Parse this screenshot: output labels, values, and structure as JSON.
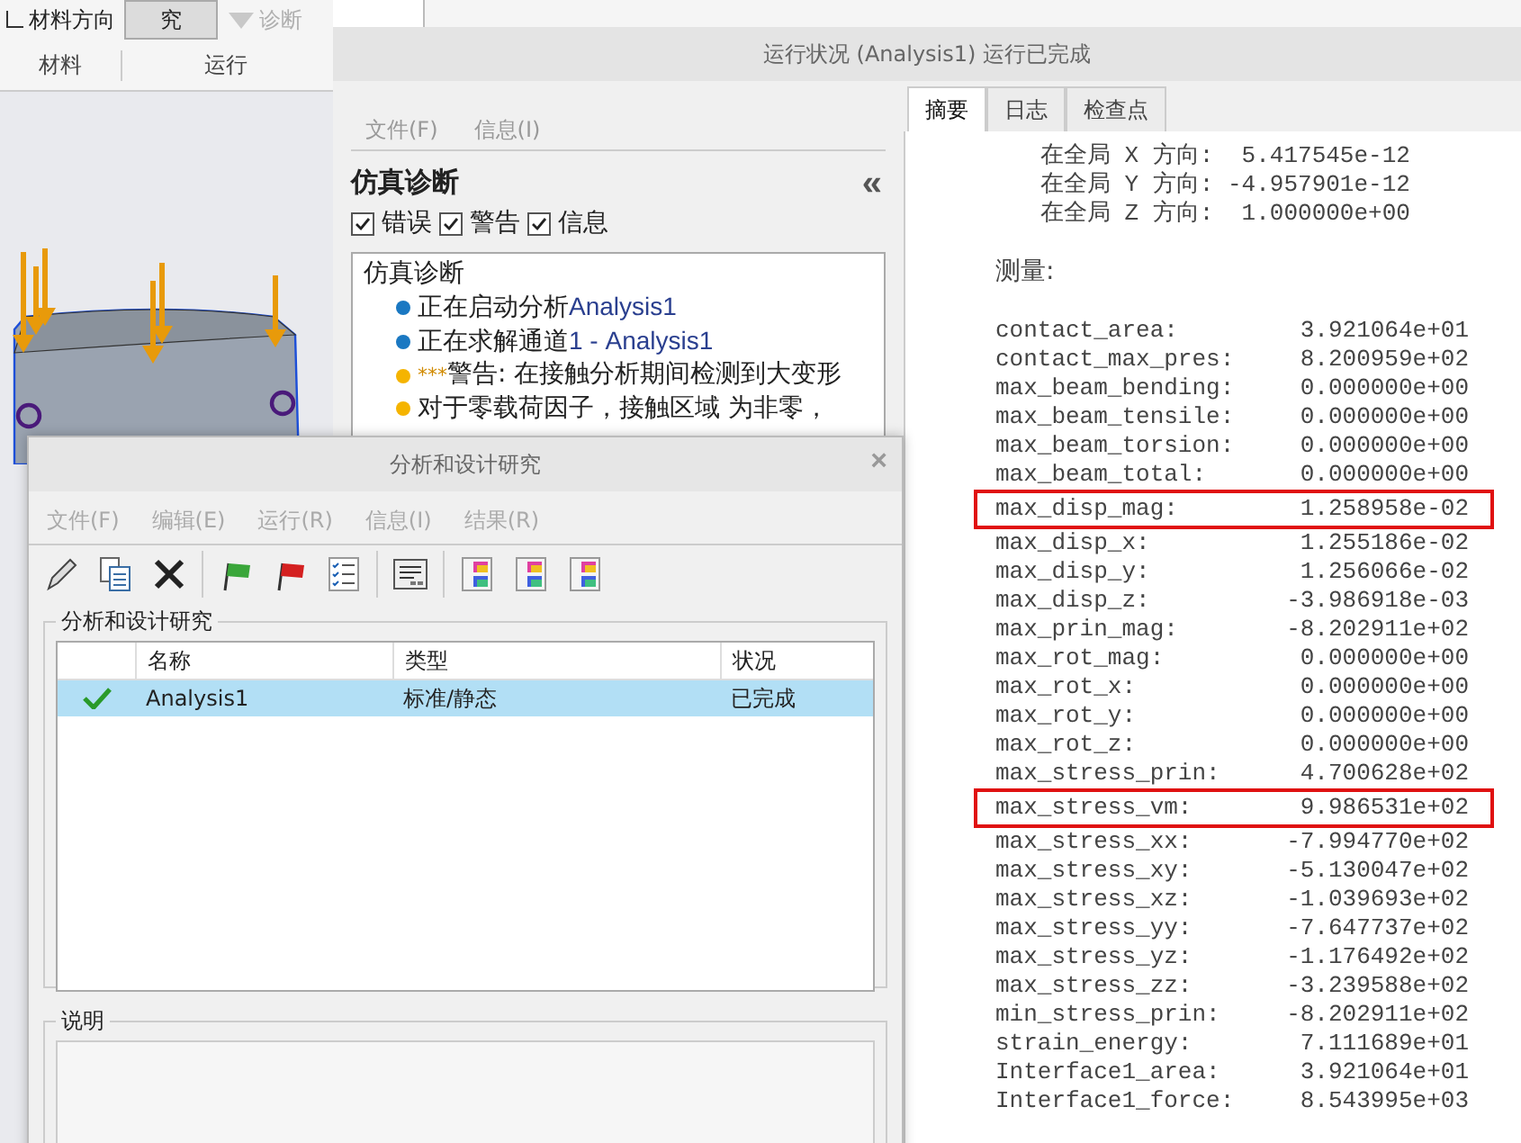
{
  "ribbon": {
    "buttons": [
      {
        "label": "材料方向",
        "kind": "normal"
      },
      {
        "label": "究",
        "kind": "pressed"
      },
      {
        "label": "诊断",
        "kind": "disabled"
      }
    ],
    "groups": [
      "材料",
      "运行"
    ]
  },
  "run_window": {
    "title": "运行状况 (Analysis1) 运行已完成",
    "menu": [
      "文件(F)",
      "信息(I)"
    ],
    "diagnostics": {
      "title": "仿真诊断",
      "collapse": "«",
      "filters": [
        {
          "label": "错误",
          "checked": true
        },
        {
          "label": "警告",
          "checked": true
        },
        {
          "label": "信息",
          "checked": true
        }
      ],
      "tree": {
        "label": "仿真诊断",
        "children": [
          {
            "text": "正在启动分析",
            "ref": "Analysis1",
            "color": "#1a78c2"
          },
          {
            "text": "正在求解通道",
            "ref": "1 - Analysis1",
            "color": "#1a78c2"
          },
          {
            "prefix": "***",
            "text": "警告: 在接触分析期间检测到大变形",
            "color": "#f5b400"
          },
          {
            "text": "对于零载荷因子，接触区域 为非零，",
            "color": "#f5b400"
          }
        ]
      }
    },
    "tabs": [
      {
        "label": "摘要",
        "selected": true
      },
      {
        "label": "日志",
        "selected": false
      },
      {
        "label": "检查点",
        "selected": false
      }
    ],
    "summary": {
      "load_lines": [
        "在全局 X 方向:  5.417545e-12",
        "在全局 Y 方向: -4.957901e-12",
        "在全局 Z 方向:  1.000000e+00"
      ],
      "measures_heading": "测量:",
      "measures": [
        {
          "name": "contact_area:",
          "value": "3.921064e+01",
          "highlighted": false
        },
        {
          "name": "contact_max_pres:",
          "value": "8.200959e+02",
          "highlighted": false
        },
        {
          "name": "max_beam_bending:",
          "value": "0.000000e+00",
          "highlighted": false
        },
        {
          "name": "max_beam_tensile:",
          "value": "0.000000e+00",
          "highlighted": false
        },
        {
          "name": "max_beam_torsion:",
          "value": "0.000000e+00",
          "highlighted": false
        },
        {
          "name": "max_beam_total:",
          "value": "0.000000e+00",
          "highlighted": false
        },
        {
          "name": "max_disp_mag:",
          "value": "1.258958e-02",
          "highlighted": true
        },
        {
          "name": "max_disp_x:",
          "value": "1.255186e-02",
          "highlighted": false
        },
        {
          "name": "max_disp_y:",
          "value": "1.256066e-02",
          "highlighted": false
        },
        {
          "name": "max_disp_z:",
          "value": "-3.986918e-03",
          "highlighted": false
        },
        {
          "name": "max_prin_mag:",
          "value": "-8.202911e+02",
          "highlighted": false
        },
        {
          "name": "max_rot_mag:",
          "value": "0.000000e+00",
          "highlighted": false
        },
        {
          "name": "max_rot_x:",
          "value": "0.000000e+00",
          "highlighted": false
        },
        {
          "name": "max_rot_y:",
          "value": "0.000000e+00",
          "highlighted": false
        },
        {
          "name": "max_rot_z:",
          "value": "0.000000e+00",
          "highlighted": false
        },
        {
          "name": "max_stress_prin:",
          "value": "4.700628e+02",
          "highlighted": false
        },
        {
          "name": "max_stress_vm:",
          "value": "9.986531e+02",
          "highlighted": true
        },
        {
          "name": "max_stress_xx:",
          "value": "-7.994770e+02",
          "highlighted": false
        },
        {
          "name": "max_stress_xy:",
          "value": "-5.130047e+02",
          "highlighted": false
        },
        {
          "name": "max_stress_xz:",
          "value": "-1.039693e+02",
          "highlighted": false
        },
        {
          "name": "max_stress_yy:",
          "value": "-7.647737e+02",
          "highlighted": false
        },
        {
          "name": "max_stress_yz:",
          "value": "-1.176492e+02",
          "highlighted": false
        },
        {
          "name": "max_stress_zz:",
          "value": "-3.239588e+02",
          "highlighted": false
        },
        {
          "name": "min_stress_prin:",
          "value": "-8.202911e+02",
          "highlighted": false
        },
        {
          "name": "strain_energy:",
          "value": "7.111689e+01",
          "highlighted": false
        },
        {
          "name": "Interface1_area:",
          "value": "3.921064e+01",
          "highlighted": false
        },
        {
          "name": "Interface1_force:",
          "value": "8.543995e+03",
          "highlighted": false
        }
      ]
    }
  },
  "study_dialog": {
    "title": "分析和设计研究",
    "close": "×",
    "menu": [
      "文件(F)",
      "编辑(E)",
      "运行(R)",
      "信息(I)",
      "结果(R)"
    ],
    "group_title": "分析和设计研究",
    "columns": [
      "名称",
      "类型",
      "状况"
    ],
    "rows": [
      {
        "done": true,
        "selected": true,
        "name": "Analysis1",
        "type": "标准/静态",
        "status": "已完成"
      }
    ],
    "notes_title": "说明"
  }
}
